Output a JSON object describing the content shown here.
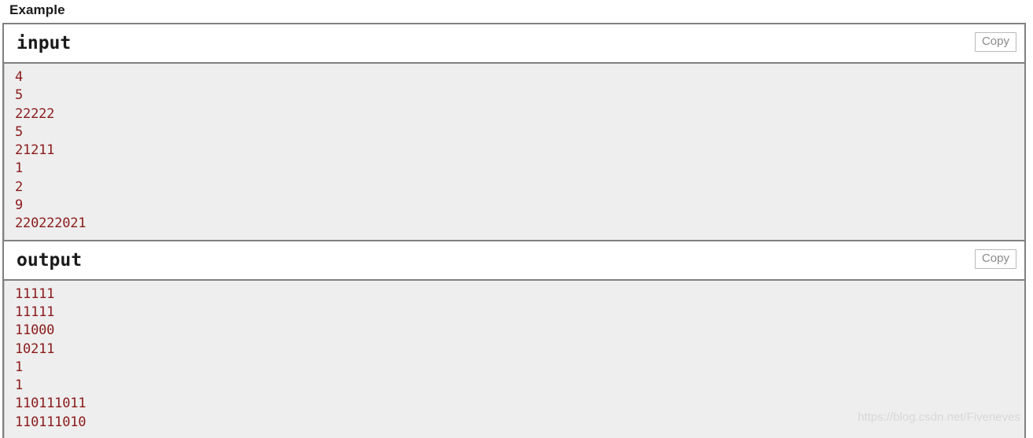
{
  "page": {
    "heading": "Example",
    "watermark": "https://blog.csdn.net/Fiveneves"
  },
  "colors": {
    "data_text": "#8b1a1a",
    "pane_background": "#eeeeee",
    "border": "#808080",
    "copy_label": "#8a8a8a",
    "heading_text": "#1a1a1a",
    "watermark_text": "#d8d8d8"
  },
  "blocks": [
    {
      "title": "input",
      "copy_label": "Copy",
      "lines": [
        "4",
        "5",
        "22222",
        "5",
        "21211",
        "1",
        "2",
        "9",
        "220222021"
      ]
    },
    {
      "title": "output",
      "copy_label": "Copy",
      "lines": [
        "11111",
        "11111",
        "11000",
        "10211",
        "1",
        "1",
        "110111011",
        "110111010"
      ]
    }
  ]
}
